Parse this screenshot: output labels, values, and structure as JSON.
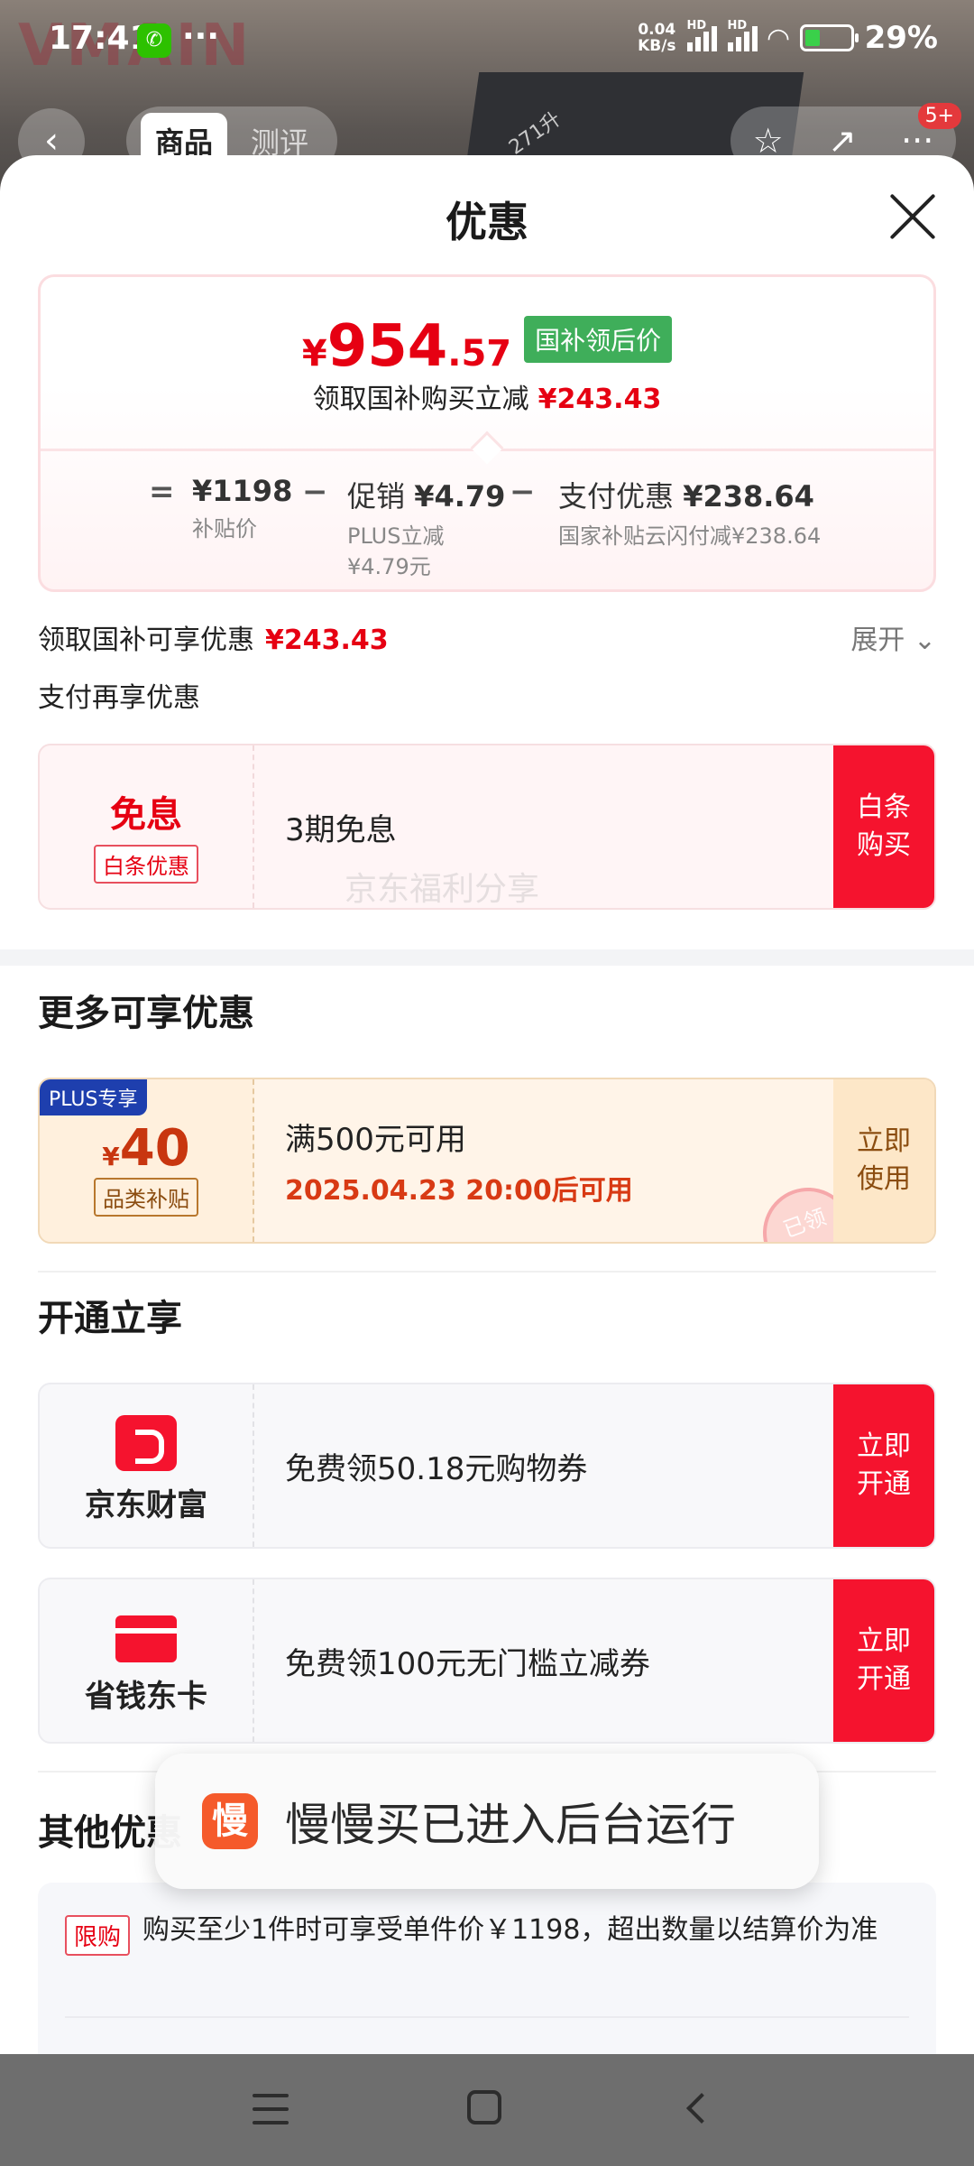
{
  "status_bar": {
    "time": "17:41",
    "net_speed_top": "0.04",
    "net_speed_unit": "KB/s",
    "signal_tag": "HD",
    "battery": "29%",
    "icons": [
      "wechat-icon",
      "more-icon",
      "signal-icon",
      "wifi-icon",
      "battery-icon"
    ]
  },
  "background_page": {
    "brand_text": "VMAIN",
    "product_label": "271升",
    "tabs": [
      "商品",
      "测评"
    ],
    "badge": "5+"
  },
  "sheet": {
    "title": "优惠",
    "price_card": {
      "price_yen": "¥",
      "price_int": "954",
      "price_dec": ".57",
      "tag": "国补领后价",
      "subtitle": "领取国补购买立减",
      "subtitle_amount": "¥243.43",
      "eq": "=",
      "base_value": "¥1198",
      "base_caption": "补贴价",
      "minus": "−",
      "promo_label": "促销",
      "promo_value": "¥4.79",
      "promo_caption_1": "PLUS立减",
      "promo_caption_2": "¥4.79元",
      "pay_label": "支付优惠",
      "pay_value": "¥238.64",
      "pay_caption": "国家补贴云闪付减¥238.64"
    },
    "gov_line": {
      "label": "领取国补可享优惠",
      "amount": "¥243.43",
      "expand": "展开"
    },
    "pay_heading": "支付再享优惠",
    "baitiao": {
      "big": "免息",
      "chip": "白条优惠",
      "text": "3期免息",
      "button": "白条购买"
    },
    "more_title": "更多可享优惠",
    "watermark": "京东福利分享",
    "plus_coupon": {
      "tag": "PLUS专享",
      "yen": "¥",
      "amount": "40",
      "chip": "品类补贴",
      "line1": "满500元可用",
      "line2": "2025.04.23 20:00后可用",
      "button": "立即使用",
      "stamp": "已领"
    },
    "open_title": "开通立享",
    "jd_wealth": {
      "name": "京东财富",
      "text": "免费领50.18元购物券",
      "button": "立即开通"
    },
    "save_card": {
      "name": "省钱东卡",
      "text": "免费领100元无门槛立减券",
      "button": "立即开通"
    },
    "other_title": "其他优惠",
    "limit": {
      "tag": "限购",
      "text": "购买至少1件时可享受单件价￥1198，超出数量以结算价为准"
    }
  },
  "toast": {
    "icon_char": "慢",
    "text": "慢慢买已进入后台运行"
  },
  "navbar": {
    "icons": [
      "menu-icon",
      "home-icon",
      "back-icon"
    ]
  }
}
